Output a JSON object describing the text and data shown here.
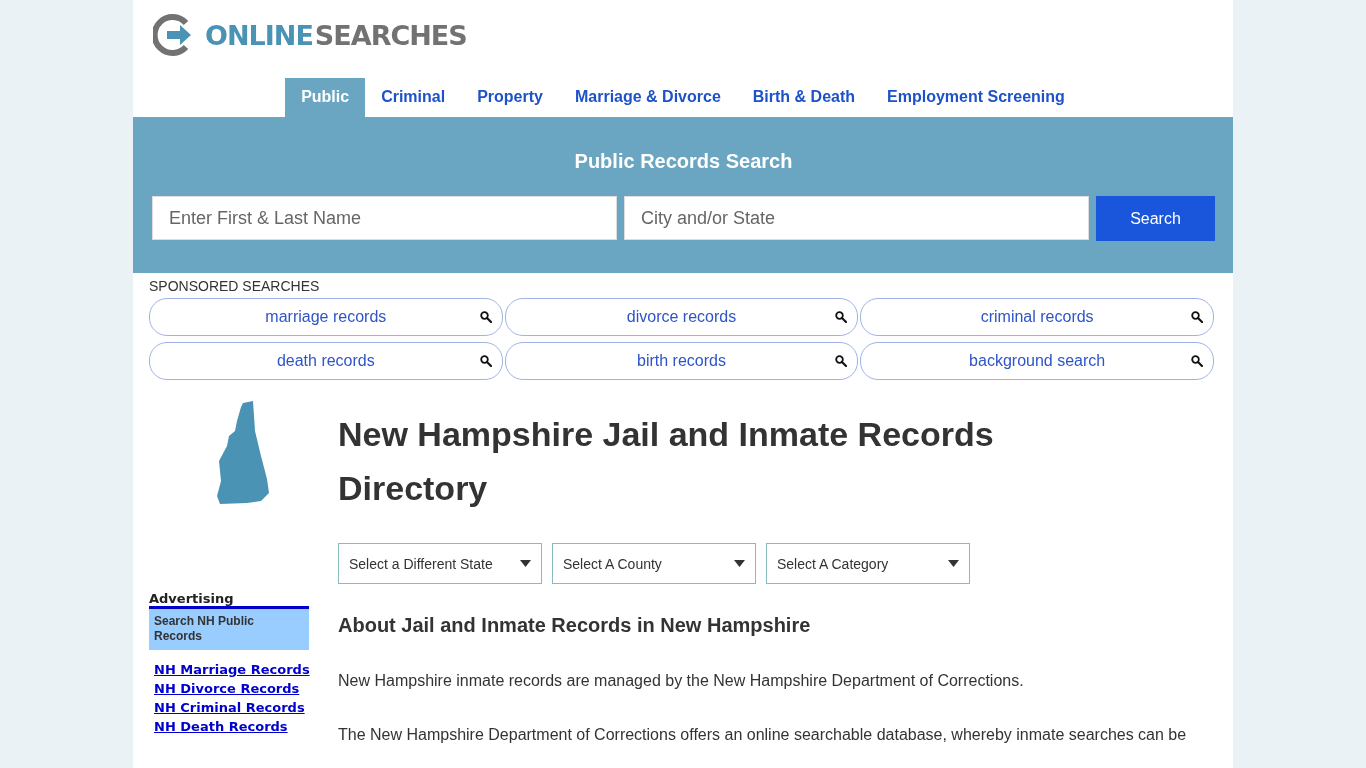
{
  "logo": {
    "first": "ONLINE",
    "second": "SEARCHES"
  },
  "nav": [
    {
      "label": "Public",
      "selected": true
    },
    {
      "label": "Criminal",
      "selected": false
    },
    {
      "label": "Property",
      "selected": false
    },
    {
      "label": "Marriage & Divorce",
      "selected": false
    },
    {
      "label": "Birth & Death",
      "selected": false
    },
    {
      "label": "Employment Screening",
      "selected": false
    }
  ],
  "search_panel": {
    "title": "Public Records Search",
    "name_placeholder": "Enter First & Last Name",
    "location_placeholder": "City and/or State",
    "button": "Search"
  },
  "sponsored": {
    "heading": "SPONSORED SEARCHES",
    "items": [
      "marriage records",
      "divorce records",
      "criminal records",
      "death records",
      "birth records",
      "background search"
    ]
  },
  "sidebar": {
    "heading": "Advertising",
    "box": "Search NH Public Records",
    "links": [
      "NH Marriage Records",
      "NH Divorce Records",
      "NH Criminal Records",
      "NH Death Records"
    ]
  },
  "main": {
    "title": "New Hampshire Jail and Inmate Records Directory",
    "selects": [
      "Select a Different State",
      "Select A County",
      "Select A Category"
    ],
    "heading": "About Jail and Inmate Records in New Hampshire",
    "paragraphs": [
      "New Hampshire inmate records are managed by the New Hampshire Department of Corrections.",
      "The New Hampshire Department of Corrections offers an online searchable database, whereby inmate searches can be"
    ]
  }
}
